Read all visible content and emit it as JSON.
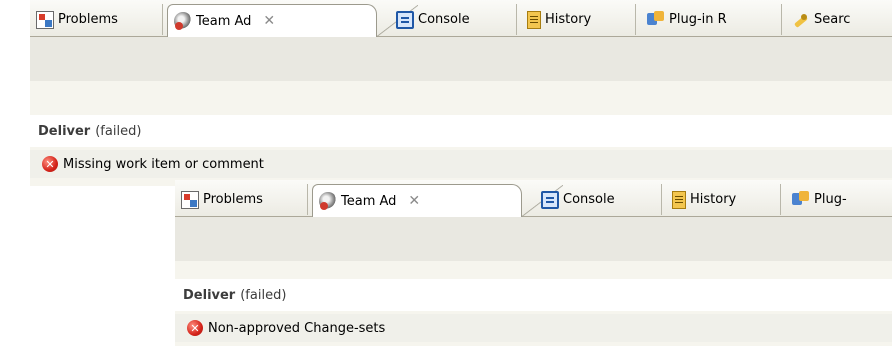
{
  "panels": [
    {
      "tabs": [
        {
          "label": "Problems",
          "icon": "problems-icon"
        },
        {
          "label": "Team Ad",
          "icon": "team-advisor-icon",
          "close": "✕",
          "active": true
        },
        {
          "label": "Console",
          "icon": "console-icon"
        },
        {
          "label": "History",
          "icon": "history-icon"
        },
        {
          "label": "Plug-in R",
          "icon": "plugin-icon"
        },
        {
          "label": "Searc",
          "icon": "search-icon"
        }
      ],
      "section": {
        "title": "Deliver",
        "status": "(failed)"
      },
      "error_message": "Missing work item or comment",
      "error_glyph": "✕"
    },
    {
      "tabs": [
        {
          "label": "Problems",
          "icon": "problems-icon"
        },
        {
          "label": "Team Ad",
          "icon": "team-advisor-icon",
          "close": "✕",
          "active": true
        },
        {
          "label": "Console",
          "icon": "console-icon"
        },
        {
          "label": "History",
          "icon": "history-icon"
        },
        {
          "label": "Plug-",
          "icon": "plugin-icon"
        }
      ],
      "section": {
        "title": "Deliver",
        "status": "(failed)"
      },
      "error_message": "Non-approved Change-sets",
      "error_glyph": "✕"
    }
  ],
  "colors": {
    "error": "#d4231a",
    "tab_active_bg": "#ffffff",
    "toolbar_bg": "#e9e8e1"
  }
}
